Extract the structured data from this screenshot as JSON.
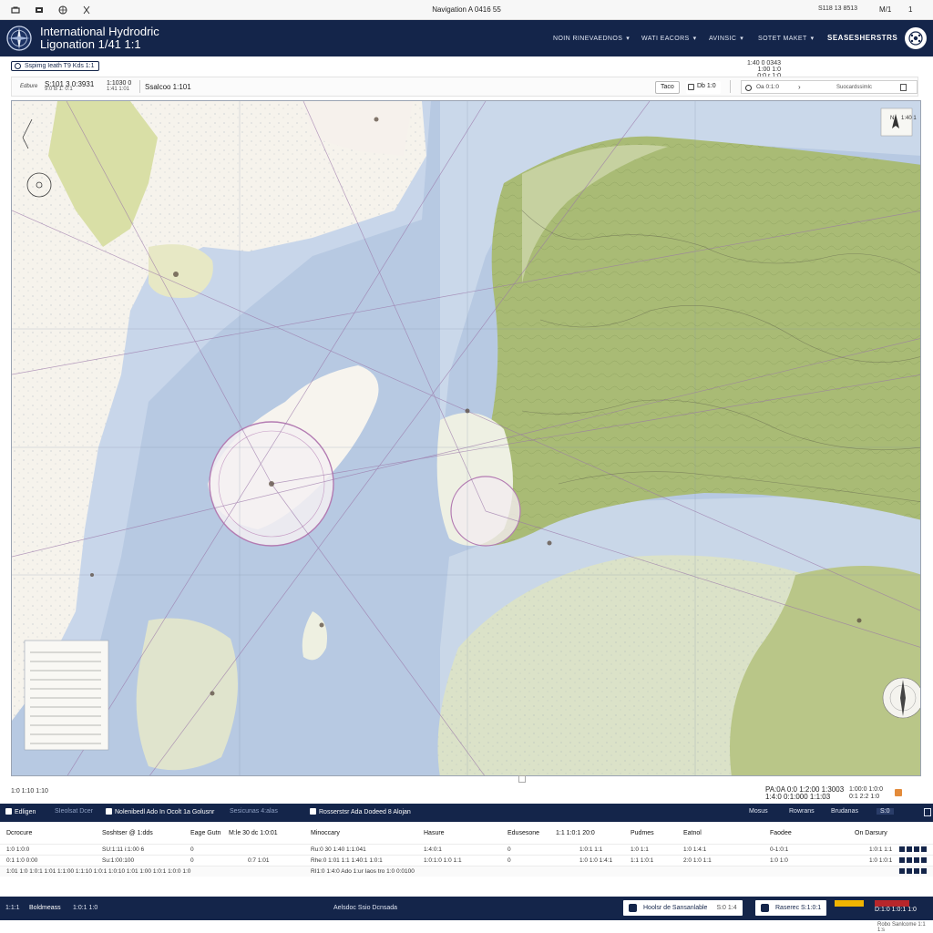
{
  "topbar": {
    "title": "Navigation A 0416 55",
    "right_a": "S118 13 8513",
    "right_b": "M/1",
    "right_c": "1"
  },
  "header": {
    "brand_line1": "International Hydrodric",
    "brand_line2": "Ligonation 1/41 1:1",
    "nav": [
      {
        "label": "NOIN RINEVAEDNOS"
      },
      {
        "label": "WATI EACORS"
      },
      {
        "label": "AVINSIC"
      },
      {
        "label": "SOTET MAKET"
      }
    ],
    "nav_right": "SEASESHERSTRS"
  },
  "toolbar": {
    "tag_label": "Sspimg Ieath T9 Kds 1:1",
    "scale_line1": "1:40 0 0343",
    "scale_line2": "1:00 1:0",
    "scale_line3": "0:0 r 1:0"
  },
  "coords": {
    "label": "Edbure",
    "lat": "S:101 3 0:3931",
    "lat_sub": "9:0 B 1: 0:1",
    "lon": "1:1030 0",
    "lon_sub": "1:41 1:01",
    "search_value": "Ssalcoo 1:101",
    "btn_zoom": "Taco",
    "btn_layers": "Db 1:0",
    "btn_route": "Oa 0:1:0",
    "field_value": "Suocardssimlc"
  },
  "map": {
    "inset_label": "1:40 1",
    "compass": "N"
  },
  "under_map": {
    "scale": "1:0 1:10    1:10",
    "coords_line1": "PA:0A 0:0 1:2:00 1:3003",
    "coords_line2": "1:4:0 0:1:000 1:1:03",
    "pos_line1": "1:00:0 1:0:0",
    "pos_line2": "0:1 2:2 1:0"
  },
  "panel": {
    "tabs": [
      {
        "label": "Edligen"
      },
      {
        "label": "SIeolsat Dcer"
      },
      {
        "label": "Nolenibedl Ado In Ocolt 1a Golusnr"
      },
      {
        "label": "Sesicunas 4:alas"
      },
      {
        "label": "Rosserstsr Ada Dodeed 8 Alojan"
      }
    ],
    "right_tools": [
      "Mosus",
      "Rowrans",
      "Brudanas",
      "S:0"
    ],
    "columns": [
      "Dcrocure",
      "Soshtser @ 1:dds",
      "Eage Gutn",
      "M:le 30 dc 1:0:01",
      "Minoccary",
      "Hasure",
      "Edusesone",
      "1:1 1:0:1 20:0",
      "Pudmes",
      "Eatnol",
      "Faodee",
      "On Darsury"
    ],
    "rows": [
      [
        "1:0 1:0:0",
        "SU:1:11 i:1:00 6",
        "0",
        "",
        "Ru:0 30 1:40 1:1:041",
        "1:4:0:1",
        "0",
        "1:0:1 1:1",
        "1:0 1:1",
        "1:0 1:4:1",
        "0-1:0:1",
        "1:0:1 1:1"
      ],
      [
        "0:1 1:0 0:00",
        "Su:1:00:100",
        "0",
        "0:7 1:01",
        "Rhe:0 1:01 1:1 1:40:1 1:0:1",
        "1:0:1:0 1:0 1:1",
        "0",
        "1:0 1:0 1:4:1",
        "1:1 1:0:1",
        "2:0 1:0 1:1",
        "1:0 1:0",
        "1:0 1:0:1"
      ]
    ],
    "footer_left": "1:01 1:0 1:0:1 1:01 1:1:00 1:1:10 1:0:1 1:0:10 1:01 1:00 1:0:1 1:0:0 1:0",
    "footer_mid": "RI1:0 1:4:0 Ado 1:ur Iaos tro 1:0 0:0100"
  },
  "statusbar": {
    "left_a": "1:1:1",
    "left_b": "Boldmeass",
    "left_c": "1:0:1 1:0",
    "center": "Aelsdoc Ssio Dcnsada",
    "btn1_label": "Hoolsr de Sansanlable",
    "btn1_sub": "S:0 1:4",
    "btn2_label": "Raserec S:1:0:1",
    "legend_text": "D:1:0 1:0:1 1:0",
    "copyright": "Robo Sanlcome 1:1 1:s",
    "colors": {
      "navy": "#14254a",
      "legend_yellow": "#f0b400",
      "legend_red": "#b7262b",
      "land_green": "#9db266",
      "water_blue": "#b9cbe4"
    }
  }
}
